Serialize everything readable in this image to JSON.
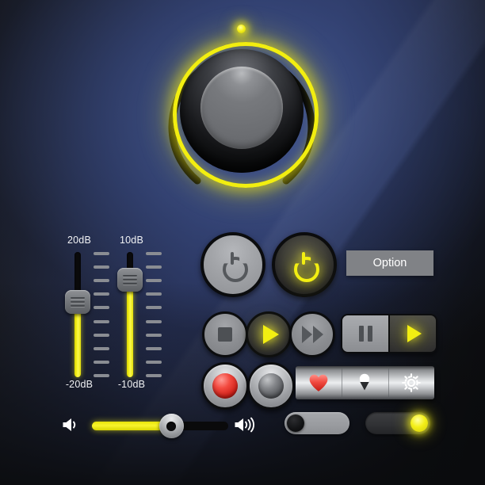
{
  "panel": {
    "background_dark": "#141518",
    "background_blue": "#2e3a66",
    "accent_yellow": "#f2ee12",
    "accent_red": "#f34a40"
  },
  "knob": {
    "name": "main-rotary-knob",
    "indicator_position": "top",
    "ring_color": "#f2ee12",
    "arc_color": "#000000"
  },
  "sliders": [
    {
      "name": "gain-slider-1",
      "top_label": "20dB",
      "bottom_label": "-20dB",
      "knob_percent_from_top": 40,
      "tick_count": 10
    },
    {
      "name": "gain-slider-2",
      "top_label": "10dB",
      "bottom_label": "-10dB",
      "knob_percent_from_top": 22,
      "tick_count": 10
    }
  ],
  "buttons": {
    "power_off_label": "power",
    "power_on_label": "power",
    "option_label": "Option",
    "stop_label": "stop",
    "play_label": "play",
    "forward_label": "fast-forward",
    "pause_label": "pause",
    "segment_play_label": "play",
    "record_label": "record",
    "blank_label": "blank"
  },
  "icon_bar": {
    "items": [
      {
        "name": "heart-icon",
        "label": "Favorite",
        "color": "#f34a40"
      },
      {
        "name": "location-pin-icon",
        "label": "Location",
        "color": "#ffffff"
      },
      {
        "name": "gear-icon",
        "label": "Settings",
        "color": "#ffffff"
      }
    ]
  },
  "volume": {
    "name": "volume-slider",
    "value_percent": 58,
    "mute_icon": "speaker-mute-icon",
    "high_icon": "speaker-high-icon"
  },
  "toggles": [
    {
      "name": "toggle-switch-off",
      "state": "off",
      "knob_color": "#0d0d0f"
    },
    {
      "name": "toggle-switch-on",
      "state": "on",
      "knob_color": "#f2ee12"
    }
  ]
}
